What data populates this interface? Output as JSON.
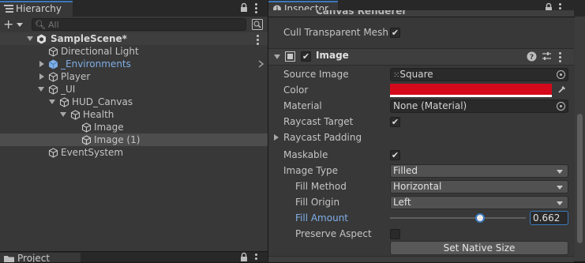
{
  "hierarchy": {
    "tab_title": "Hierarchy",
    "search_placeholder": "All",
    "scene_name": "SampleScene*",
    "items": [
      {
        "label": "Directional Light"
      },
      {
        "label": "_Environments"
      },
      {
        "label": "Player"
      },
      {
        "label": "_UI"
      },
      {
        "label": "HUD_Canvas"
      },
      {
        "label": "Health"
      },
      {
        "label": "Image"
      },
      {
        "label": "Image (1)"
      },
      {
        "label": "EventSystem"
      }
    ],
    "bottom_tab": "Project"
  },
  "inspector": {
    "tab_title": "Inspector",
    "cut_header": "Canvas Renderer",
    "cull_label": "Cull Transparent Mesh",
    "component_title": "Image",
    "source_image_label": "Source Image",
    "source_image_value": "Square",
    "color_label": "Color",
    "color_value": "#d4091c",
    "material_label": "Material",
    "material_value": "None (Material)",
    "raycast_target_label": "Raycast Target",
    "raycast_padding_label": "Raycast Padding",
    "maskable_label": "Maskable",
    "image_type_label": "Image Type",
    "image_type_value": "Filled",
    "fill_method_label": "Fill Method",
    "fill_method_value": "Horizontal",
    "fill_origin_label": "Fill Origin",
    "fill_origin_value": "Left",
    "fill_amount_label": "Fill Amount",
    "fill_amount_value": "0.662",
    "preserve_aspect_label": "Preserve Aspect",
    "set_native_size_label": "Set Native Size"
  },
  "colors": {
    "accent": "#3a79bb",
    "prefab_blue": "#7faee6",
    "selection": "#4d4d4d",
    "fill_color": "#d4091c"
  }
}
